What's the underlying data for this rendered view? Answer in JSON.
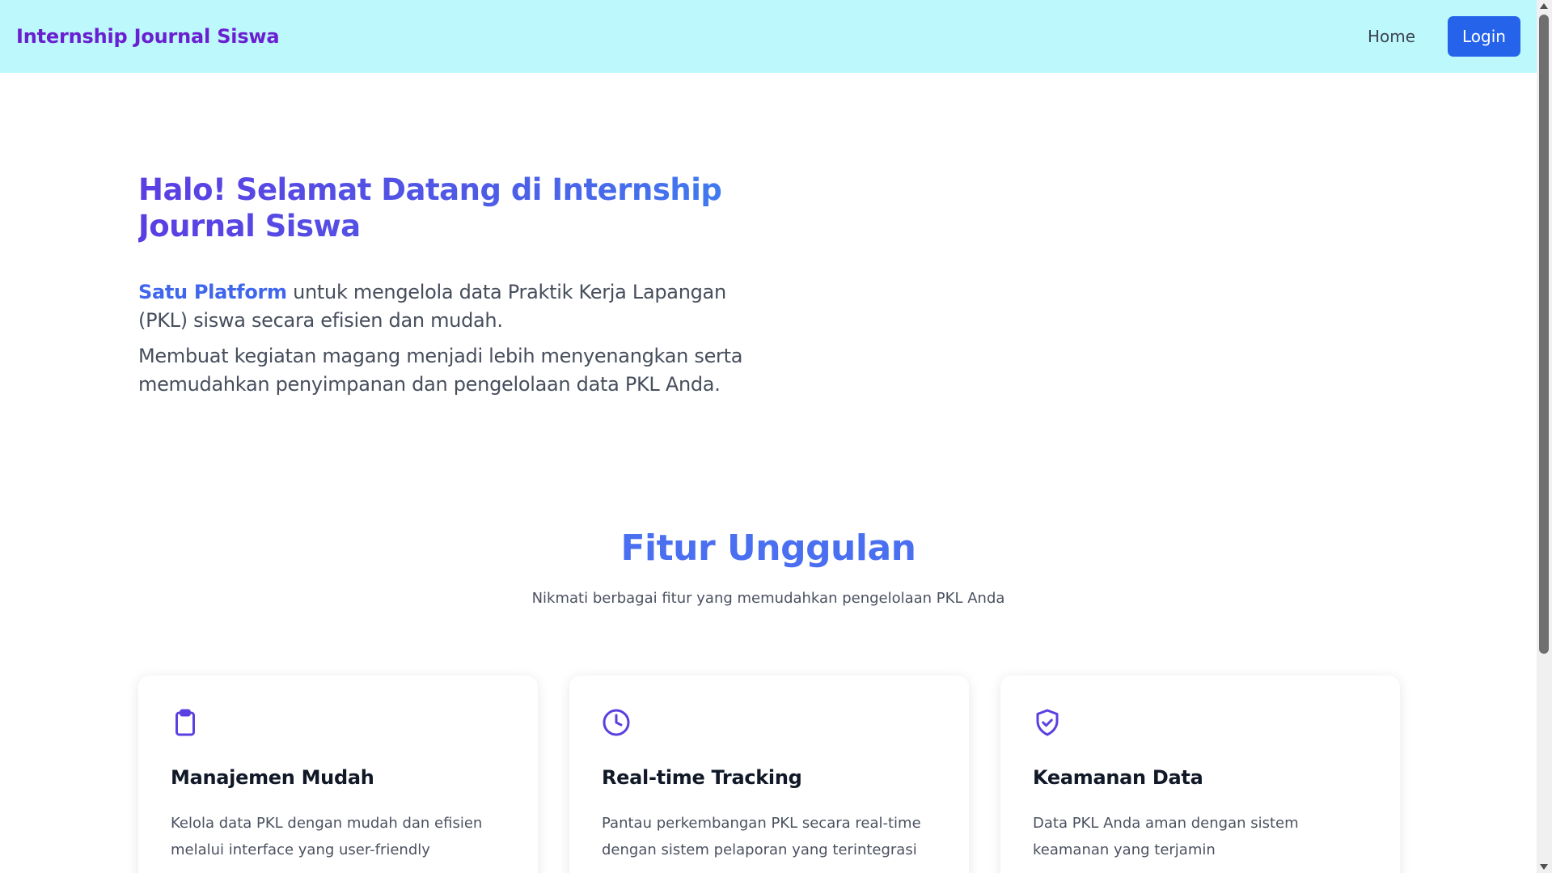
{
  "navbar": {
    "brand": "Internship Journal Siswa",
    "home_label": "Home",
    "login_label": "Login",
    "background": "#bdf8fd",
    "brand_color": "#6a1fd1",
    "login_color": "#2563eb"
  },
  "hero": {
    "title": "Halo! Selamat Datang di Internship Journal Siswa",
    "highlight": "Satu Platform",
    "paragraph1_rest": " untuk mengelola data Praktik Kerja Lapangan (PKL) siswa secara efisien dan mudah.",
    "paragraph2": "Membuat kegiatan magang menjadi lebih menyenangkan serta memudahkan penyimpanan dan pengelolaan data PKL Anda."
  },
  "features": {
    "title": "Fitur Unggulan",
    "subtitle": "Nikmati berbagai fitur yang memudahkan pengelolaan PKL Anda",
    "icon_color": "#5b3fe0",
    "cards": [
      {
        "icon": "clipboard-icon",
        "title": "Manajemen Mudah",
        "description": "Kelola data PKL dengan mudah dan efisien melalui interface yang user-friendly"
      },
      {
        "icon": "clock-icon",
        "title": "Real-time Tracking",
        "description": "Pantau perkembangan PKL secara real-time dengan sistem pelaporan yang terintegrasi"
      },
      {
        "icon": "shield-check-icon",
        "title": "Keamanan Data",
        "description": "Data PKL Anda aman dengan sistem keamanan yang terjamin"
      }
    ]
  }
}
